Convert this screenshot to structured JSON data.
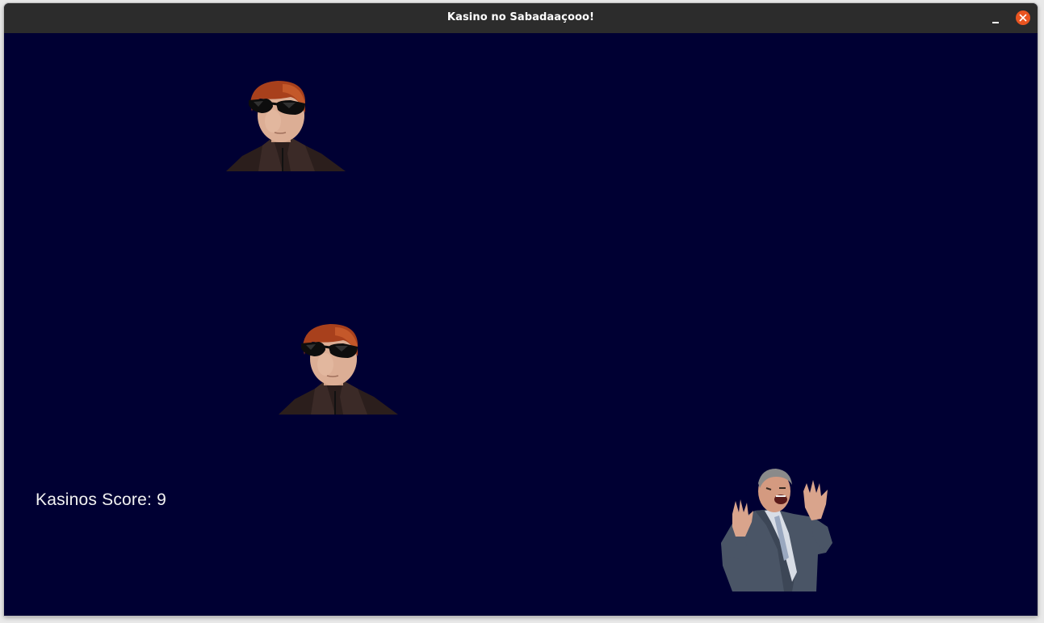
{
  "window": {
    "title": "Kasino no Sabadaaçooo!",
    "minimize_icon": "minimize-icon",
    "close_icon": "close-icon",
    "close_color": "#e95420",
    "titlebar_color": "#2c2c2c"
  },
  "game": {
    "background_color": "#000033",
    "score_label": "Kasinos Score: 9",
    "enemies": [
      {
        "name": "kasino-sunglasses-guy",
        "icon": "person-sunglasses-icon"
      },
      {
        "name": "kasino-sunglasses-guy",
        "icon": "person-sunglasses-icon"
      }
    ],
    "player": {
      "name": "shouting-man-in-suit",
      "icon": "person-suit-icon"
    }
  }
}
